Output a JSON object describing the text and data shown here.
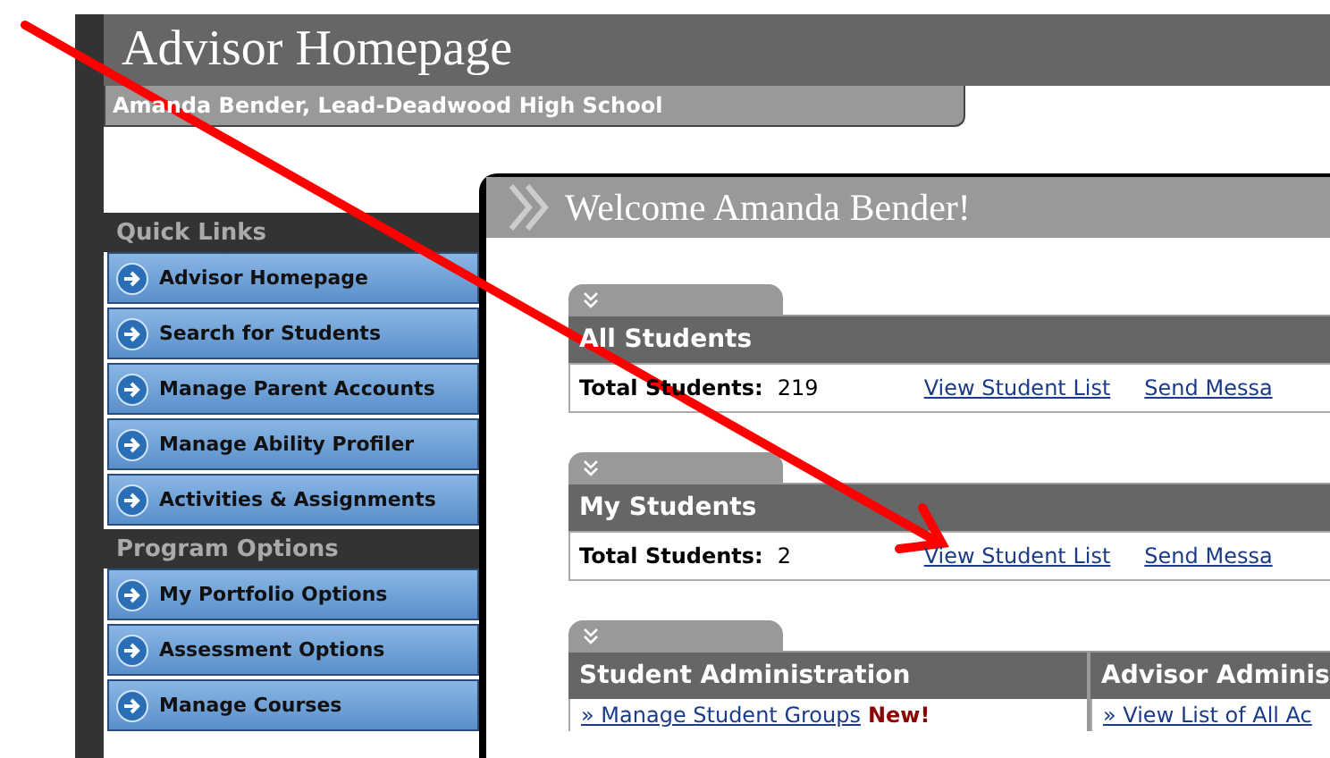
{
  "header": {
    "title": "Advisor Homepage",
    "subtitle": "Amanda Bender, Lead-Deadwood High School"
  },
  "sidebar": {
    "groups": [
      {
        "heading": "Quick Links",
        "items": [
          "Advisor Homepage",
          "Search for Students",
          "Manage Parent Accounts",
          "Manage Ability Profiler",
          "Activities & Assignments"
        ]
      },
      {
        "heading": "Program Options",
        "items": [
          "My Portfolio Options",
          "Assessment Options",
          "Manage Courses"
        ]
      }
    ]
  },
  "welcome": "Welcome Amanda Bender!",
  "sections": [
    {
      "kind": "summary",
      "title": "All Students",
      "label": "Total Students:",
      "count": "219",
      "links": [
        "View Student List",
        "Send Messa"
      ]
    },
    {
      "kind": "summary",
      "title": "My Students",
      "label": "Total Students:",
      "count": "2",
      "links": [
        "View Student List",
        "Send Messa"
      ]
    },
    {
      "kind": "columns",
      "columns": [
        {
          "title": "Student Administration",
          "items": [
            {
              "text": "» Manage Student Groups",
              "badge": "New!"
            }
          ]
        },
        {
          "title": "Advisor Adminis",
          "items": [
            {
              "text": "» View List of All Ac"
            }
          ]
        }
      ]
    }
  ]
}
